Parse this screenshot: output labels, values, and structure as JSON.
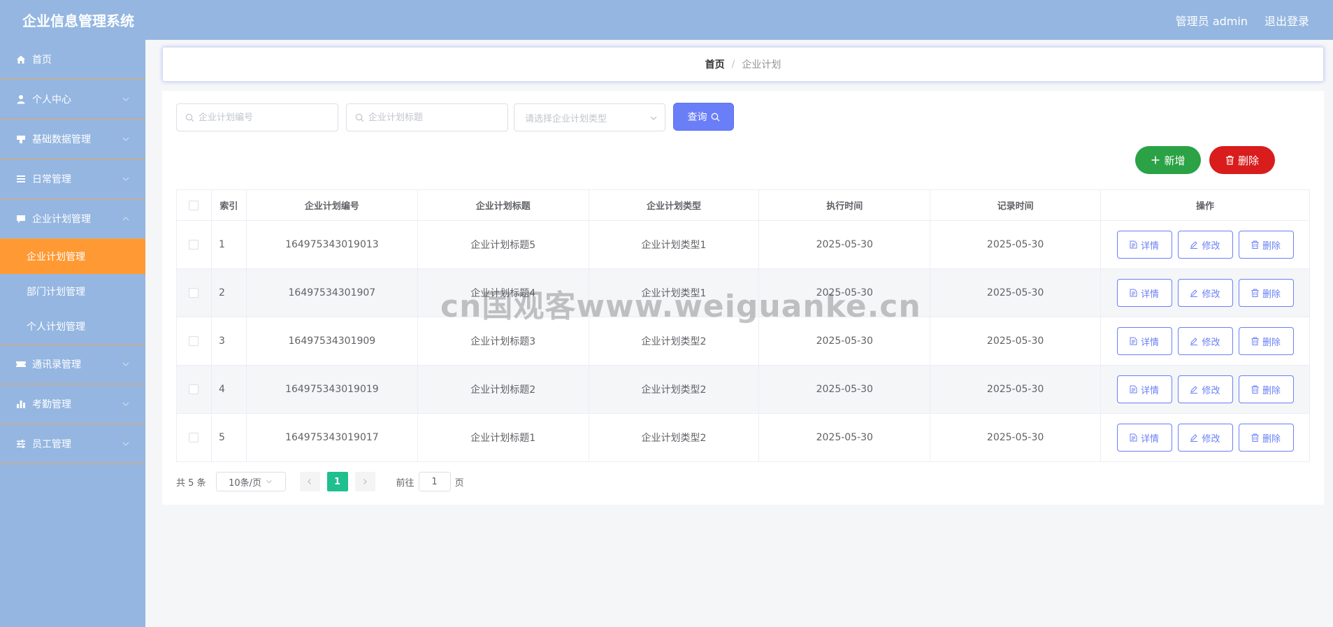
{
  "header": {
    "title": "企业信息管理系统",
    "user": "管理员 admin",
    "logout": "退出登录"
  },
  "sidebar": {
    "items": [
      {
        "label": "首页",
        "icon": "home-icon"
      },
      {
        "label": "个人中心",
        "icon": "user-icon"
      },
      {
        "label": "基础数据管理",
        "icon": "data-icon"
      },
      {
        "label": "日常管理",
        "icon": "list-icon"
      },
      {
        "label": "企业计划管理",
        "icon": "chat-icon"
      },
      {
        "label": "通讯录管理",
        "icon": "ticket-icon"
      },
      {
        "label": "考勤管理",
        "icon": "chart-icon"
      },
      {
        "label": "员工管理",
        "icon": "sliders-icon"
      }
    ],
    "sub": [
      "企业计划管理",
      "部门计划管理",
      "个人计划管理"
    ]
  },
  "breadcrumb": {
    "home": "首页",
    "sep": "/",
    "current": "企业计划"
  },
  "search": {
    "code_placeholder": "企业计划编号",
    "title_placeholder": "企业计划标题",
    "type_placeholder": "请选择企业计划类型",
    "query_label": "查询"
  },
  "actions": {
    "add_label": "新增",
    "delete_label": "删除"
  },
  "table": {
    "headers": [
      "索引",
      "企业计划编号",
      "企业计划标题",
      "企业计划类型",
      "执行时间",
      "记录时间",
      "操作"
    ],
    "rows": [
      {
        "index": "1",
        "code": "164975343019013",
        "title": "企业计划标题5",
        "type": "企业计划类型1",
        "exec": "2025-05-30",
        "record": "2025-05-30"
      },
      {
        "index": "2",
        "code": "16497534301907",
        "title": "企业计划标题4",
        "type": "企业计划类型1",
        "exec": "2025-05-30",
        "record": "2025-05-30"
      },
      {
        "index": "3",
        "code": "16497534301909",
        "title": "企业计划标题3",
        "type": "企业计划类型2",
        "exec": "2025-05-30",
        "record": "2025-05-30"
      },
      {
        "index": "4",
        "code": "164975343019019",
        "title": "企业计划标题2",
        "type": "企业计划类型2",
        "exec": "2025-05-30",
        "record": "2025-05-30"
      },
      {
        "index": "5",
        "code": "164975343019017",
        "title": "企业计划标题1",
        "type": "企业计划类型2",
        "exec": "2025-05-30",
        "record": "2025-05-30"
      }
    ],
    "ops": {
      "detail": "详情",
      "edit": "修改",
      "delete": "删除"
    }
  },
  "pagination": {
    "total": "共 5 条",
    "page_size": "10条/页",
    "current_page": "1",
    "goto_prefix": "前往",
    "goto_value": "1",
    "goto_suffix": "页"
  },
  "watermark": "cn国观客www.weiguanke.cn",
  "colors": {
    "header": "#94b6e1",
    "active_sub": "#ff9933",
    "primary": "#6a7ff7",
    "add": "#2ba245",
    "danger": "#d91c1c",
    "page_active": "#1fbf8f"
  }
}
